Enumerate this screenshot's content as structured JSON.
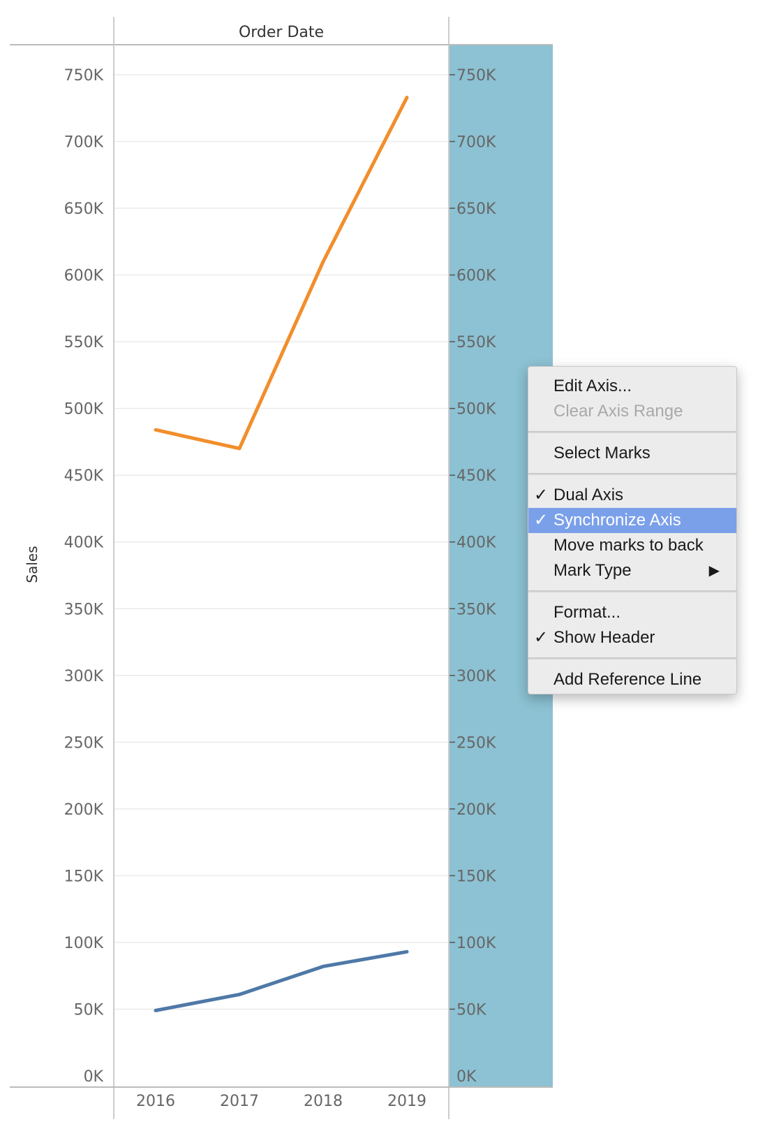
{
  "header": {
    "column_title": "Order Date"
  },
  "axes": {
    "left_title": "Sales",
    "left_ticks": [
      "750K",
      "700K",
      "650K",
      "600K",
      "550K",
      "500K",
      "450K",
      "400K",
      "350K",
      "300K",
      "250K",
      "200K",
      "150K",
      "100K",
      "50K",
      "0K"
    ],
    "right_ticks": [
      "750K",
      "700K",
      "650K",
      "600K",
      "550K",
      "500K",
      "450K",
      "400K",
      "350K",
      "300K",
      "250K",
      "200K",
      "150K",
      "100K",
      "50K",
      "0K"
    ],
    "x_labels": [
      "2016",
      "2017",
      "2018",
      "2019"
    ]
  },
  "colors": {
    "orange_series": "#f28e2b",
    "blue_series": "#4e79a7",
    "highlighted_axis": "#8cc2d3",
    "menu_highlight": "#7ba0ea"
  },
  "chart_data": {
    "type": "line",
    "x": [
      "2016",
      "2017",
      "2018",
      "2019"
    ],
    "series": [
      {
        "values": [
          484000,
          470000,
          610000,
          733000
        ]
      },
      {
        "values": [
          49000,
          61000,
          82000,
          93000
        ]
      }
    ],
    "ylabel": "Sales",
    "ylim": [
      0,
      770000
    ],
    "grid": true
  },
  "context_menu": {
    "items": [
      {
        "label": "Edit Axis...",
        "checked": false,
        "disabled": false
      },
      {
        "label": "Clear Axis Range",
        "checked": false,
        "disabled": true
      },
      {
        "label": "Select Marks",
        "checked": false,
        "disabled": false
      },
      {
        "label": "Dual Axis",
        "checked": true,
        "disabled": false
      },
      {
        "label": "Synchronize Axis",
        "checked": true,
        "disabled": false,
        "highlighted": true
      },
      {
        "label": "Move marks to back",
        "checked": false,
        "disabled": false
      },
      {
        "label": "Mark Type",
        "checked": false,
        "disabled": false,
        "submenu": true
      },
      {
        "label": "Format...",
        "checked": false,
        "disabled": false
      },
      {
        "label": "Show Header",
        "checked": true,
        "disabled": false
      },
      {
        "label": "Add Reference Line",
        "checked": false,
        "disabled": false
      }
    ],
    "check_glyph": "✓",
    "submenu_glyph": "▶"
  }
}
